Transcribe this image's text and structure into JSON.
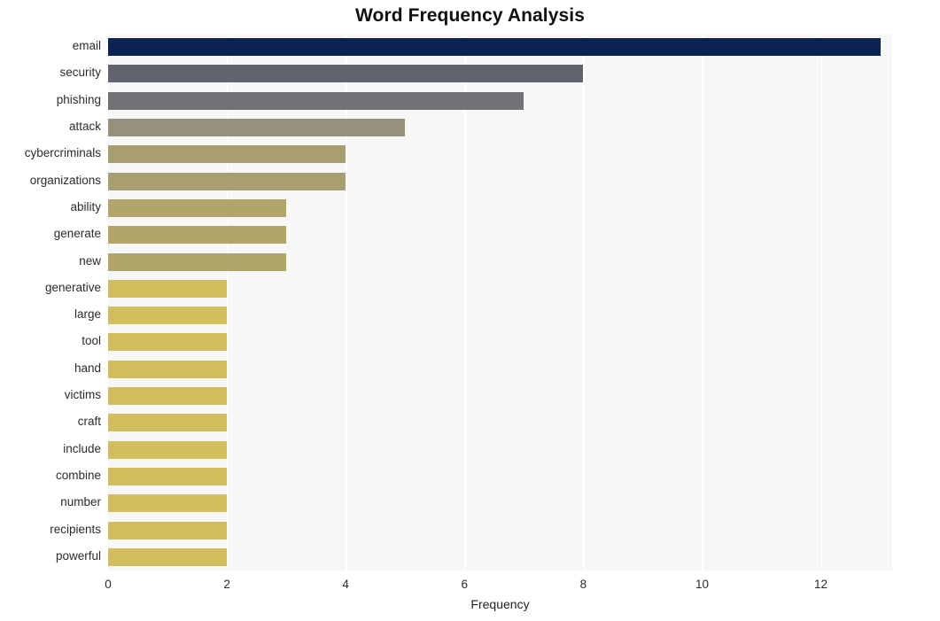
{
  "chart_data": {
    "type": "bar",
    "orientation": "horizontal",
    "title": "Word Frequency Analysis",
    "xlabel": "Frequency",
    "ylabel": "",
    "xlim": [
      0,
      13.2
    ],
    "ylim": null,
    "grid": true,
    "legend": false,
    "x_ticks": [
      0,
      2,
      4,
      6,
      8,
      10,
      12
    ],
    "x_tick_labels": [
      "0",
      "2",
      "4",
      "6",
      "8",
      "10",
      "12"
    ],
    "categories": [
      "email",
      "security",
      "phishing",
      "attack",
      "cybercriminals",
      "organizations",
      "ability",
      "generate",
      "new",
      "generative",
      "large",
      "tool",
      "hand",
      "victims",
      "craft",
      "include",
      "combine",
      "number",
      "recipients",
      "powerful"
    ],
    "values": [
      13,
      8,
      7,
      5,
      4,
      4,
      3,
      3,
      3,
      2,
      2,
      2,
      2,
      2,
      2,
      2,
      2,
      2,
      2,
      2
    ],
    "bar_colors": [
      "#0a2351",
      "#61636f",
      "#727276",
      "#95917c",
      "#a89e72",
      "#a89e72",
      "#b2a569",
      "#b2a569",
      "#b2a569",
      "#d2be5c",
      "#d2be5c",
      "#d2be5c",
      "#d2be5c",
      "#d2be5c",
      "#d2be5c",
      "#d2be5c",
      "#d2be5c",
      "#d2be5c",
      "#d2be5c",
      "#d2be5c"
    ],
    "plot_background": "#f7f7f7",
    "gridline_color": "#ffffff",
    "figure_background": "#ffffff"
  }
}
